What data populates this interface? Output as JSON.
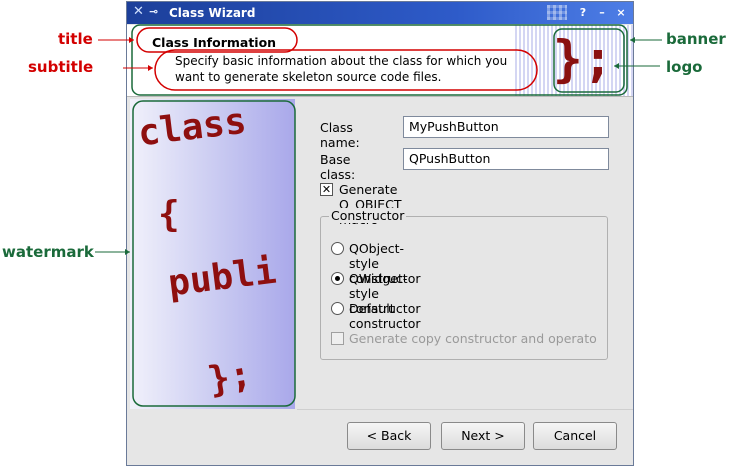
{
  "window": {
    "title": "Class Wizard",
    "controls": [
      "?",
      "–",
      "×"
    ]
  },
  "banner": {
    "title": "Class Information",
    "subtitle_line1": "Specify basic information about the class for which you",
    "subtitle_line2": "want to generate skeleton source code files.",
    "logo_text": "};"
  },
  "watermark": {
    "lines": [
      "class",
      "{",
      "publi",
      "};"
    ]
  },
  "form": {
    "class_name_label": "Class name:",
    "class_name_value": "MyPushButton",
    "base_class_label": "Base class:",
    "base_class_value": "QPushButton",
    "qobject_macro_label": "Generate Q_OBJECT macro",
    "qobject_macro_checked": true,
    "constructor_group_label": "Constructor",
    "radios": [
      {
        "label": "QObject-style constructor",
        "checked": false
      },
      {
        "label": "QWidget-style constructor",
        "checked": true
      },
      {
        "label": "Default constructor",
        "checked": false
      }
    ],
    "copy_ctor_label": "Generate copy constructor and operato",
    "copy_ctor_enabled": false
  },
  "buttons": {
    "back": "< Back",
    "next": "Next >",
    "cancel": "Cancel"
  },
  "annotations": {
    "title": "title",
    "subtitle": "subtitle",
    "watermark": "watermark",
    "banner": "banner",
    "logo": "logo"
  },
  "colors": {
    "callout_red": "#d30000",
    "callout_green": "#1a6a3a",
    "titlebar_blue": "#2e5bc9",
    "logo_red": "#8a1010"
  }
}
